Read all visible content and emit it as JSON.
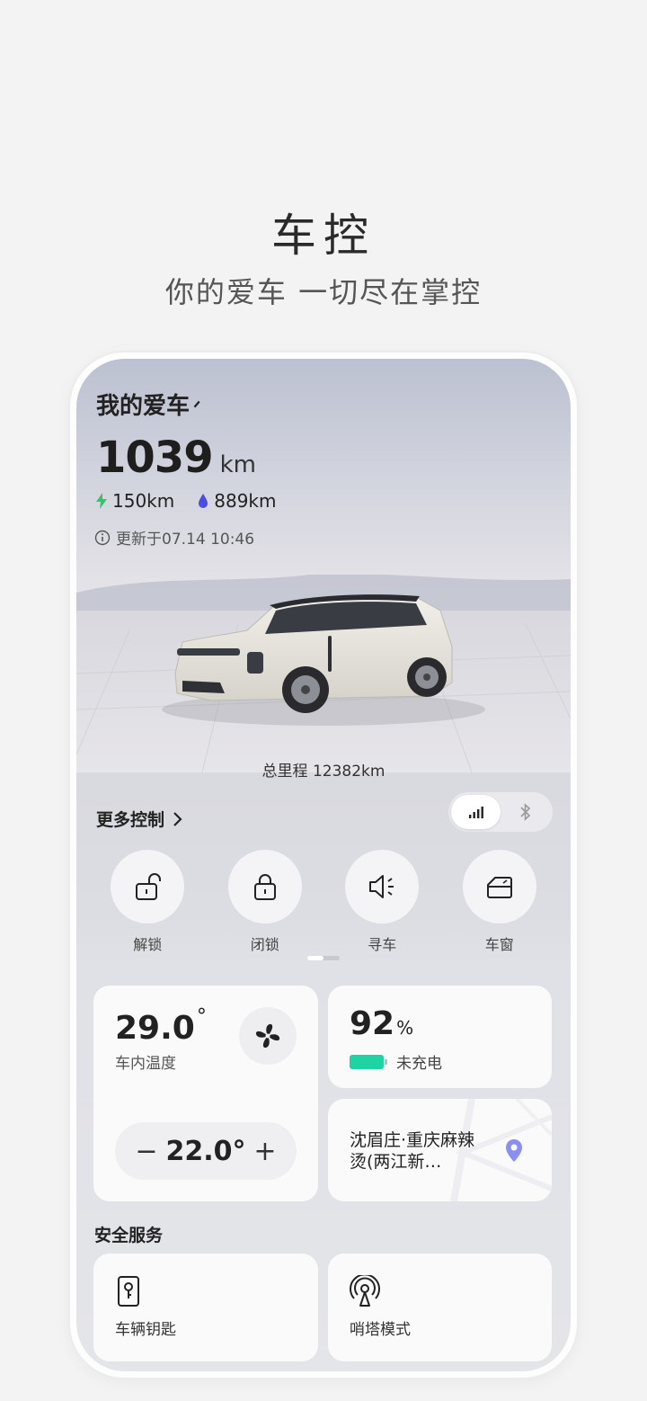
{
  "hero": {
    "title": "车控",
    "subtitle": "你的爱车 一切尽在掌控"
  },
  "screen": {
    "title": "我的爱车",
    "range": {
      "value": "1039",
      "unit": "km"
    },
    "electric_range": "150km",
    "fuel_range": "889km",
    "updated": "更新于07.14 10:46",
    "odometer": "总里程 12382km",
    "more_controls": "更多控制",
    "connection": {
      "selected": "cellular"
    },
    "controls": [
      {
        "label": "解锁",
        "icon": "unlock-icon"
      },
      {
        "label": "闭锁",
        "icon": "lock-icon"
      },
      {
        "label": "寻车",
        "icon": "horn-icon"
      },
      {
        "label": "车窗",
        "icon": "window-icon"
      }
    ],
    "climate": {
      "inside_temp": "29.0",
      "inside_label": "车内温度",
      "target_temp": "22.0°",
      "minus": "−",
      "plus": "+"
    },
    "battery": {
      "percent": "92",
      "unit": "%",
      "status": "未充电",
      "level": 0.92
    },
    "location": {
      "text": "沈眉庄·重庆麻辣烫(两江新…"
    },
    "safety": {
      "title": "安全服务",
      "items": [
        {
          "label": "车辆钥匙"
        },
        {
          "label": "哨塔模式"
        }
      ]
    }
  },
  "colors": {
    "accent_green": "#1fd3a3",
    "fuel_blue": "#4a4ee0",
    "pin_purple": "#8c8ff0",
    "electric_green": "#37c26c"
  }
}
